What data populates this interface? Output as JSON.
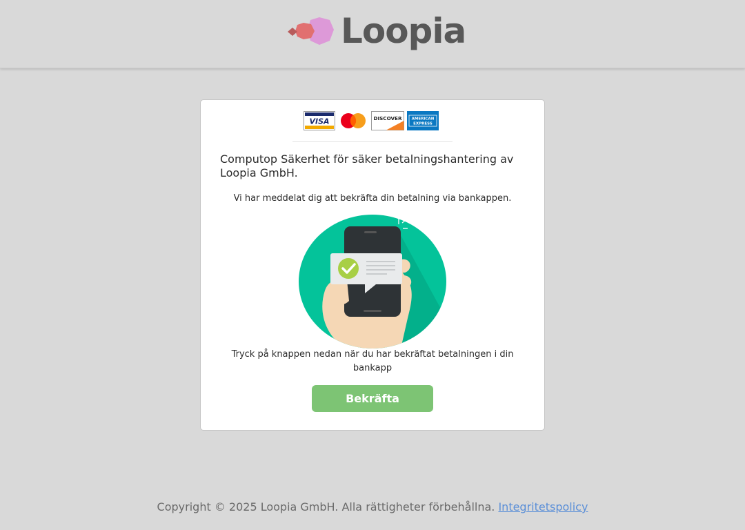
{
  "header": {
    "brand": "Loopia",
    "logo_colors": [
      "#e17070",
      "#dd99d8",
      "#b85c5c"
    ]
  },
  "card": {
    "payment_logos": [
      {
        "name": "visa-logo",
        "text": "VISA"
      },
      {
        "name": "mastercard-logo",
        "text": ""
      },
      {
        "name": "discover-logo",
        "text": "DISCOVER"
      },
      {
        "name": "amex-logo",
        "text": "AMERICAN EXPRESS"
      }
    ],
    "title": "Computop Säkerhet för säker betalningshantering av Loopia GmbH.",
    "info": "Vi har meddelat dig att bekräfta din betalning via bankappen.",
    "instruction": "Tryck på knappen nedan när du har bekräftat betalningen i din bankapp",
    "confirm_label": "Bekräfta"
  },
  "footer": {
    "copyright": "Copyright © 2025 Loopia GmbH. Alla rättigheter förbehållna.",
    "privacy_link": "Integritetspolicy"
  },
  "colors": {
    "background": "#d9d9d9",
    "button": "#7dc474",
    "link": "#5b8fd8",
    "illustration_circle": "#04c39a"
  }
}
